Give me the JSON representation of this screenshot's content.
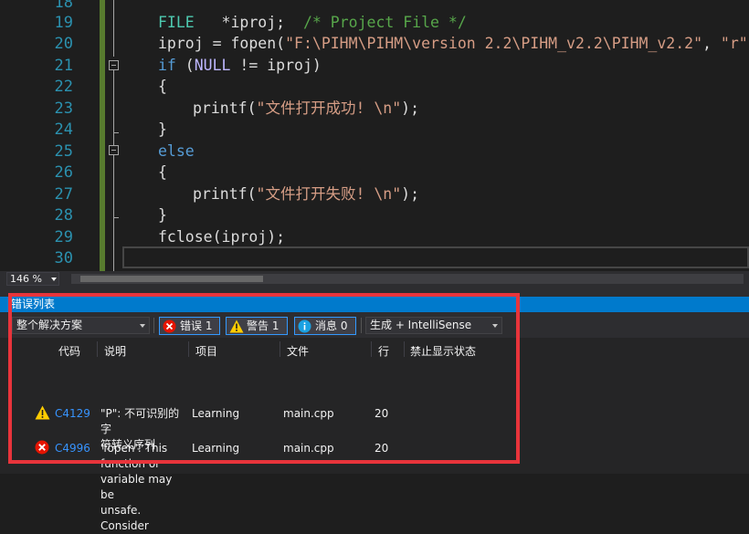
{
  "editor": {
    "line_numbers": [
      "18",
      "19",
      "20",
      "21",
      "22",
      "23",
      "24",
      "25",
      "26",
      "27",
      "28",
      "29",
      "30"
    ],
    "lines": {
      "l19": {
        "type": "FILE",
        "rest": "   *iproj;  ",
        "comment": "/* Project File */"
      },
      "l20": {
        "pre": "iproj = fopen(",
        "path": "\"F:\\PIHM\\PIHM\\version 2.2\\PIHM_v2.2\\PIHM_v2.2\"",
        "mid": ", ",
        "mode": "\"r\"",
        "post": ");"
      },
      "l21": {
        "kw": "if",
        "open": " (",
        "macro": "NULL",
        "post": " != iproj)"
      },
      "l22": "{",
      "l23": {
        "pre": "printf(",
        "str": "\"文件打开成功! \\n\"",
        "post": ");"
      },
      "l24": "}",
      "l25": "else",
      "l26": "{",
      "l27": {
        "pre": "printf(",
        "str": "\"文件打开失败! \\n\"",
        "post": ");"
      },
      "l28": "}",
      "l29": "fclose(iproj);"
    }
  },
  "status": {
    "zoom": "146 %"
  },
  "error_list": {
    "title": "错误列表",
    "scope": "整个解决方案",
    "errors_label": "错误 1",
    "warnings_label": "警告 1",
    "messages_label": "消息 0",
    "source_filter": "生成 + IntelliSense",
    "columns": [
      "代码",
      "说明",
      "项目",
      "文件",
      "行",
      "禁止显示状态"
    ],
    "rows": [
      {
        "severity": "warning-icon",
        "code": "C4129",
        "desc_lines": [
          "\"P\": 不可识别的字",
          "符转义序列"
        ],
        "project": "Learning",
        "file": "main.cpp",
        "line": "20",
        "suppression": ""
      },
      {
        "severity": "error-icon",
        "code": "C4996",
        "desc_lines": [
          "'fopen': This",
          "function or",
          "variable may be",
          "unsafe. Consider"
        ],
        "project": "Learning",
        "file": "main.cpp",
        "line": "20",
        "suppression": ""
      }
    ]
  },
  "colors": {
    "accent": "#007acc",
    "highlight": "#e8343b",
    "keyword": "#569cd6",
    "string": "#d69d85",
    "comment": "#57a64a",
    "type": "#4ec9b0",
    "error": "#e51400",
    "warning": "#ffcc00",
    "info": "#1ba1e2"
  }
}
